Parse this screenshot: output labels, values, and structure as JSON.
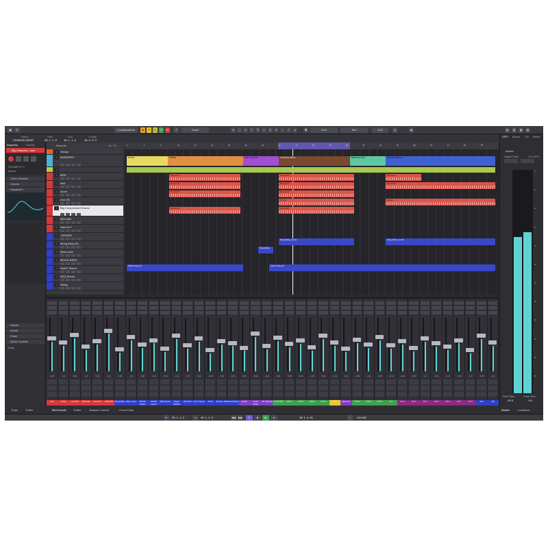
{
  "toolbar": {
    "configurations": "Configurations",
    "touch": "Touch",
    "grid": "Grid",
    "bar": "Bar",
    "quantize": "1/32",
    "section_name": "Name",
    "section_start": "Start",
    "section_end": "End",
    "section_length": "Length",
    "marker_name": "CHORUS DROP",
    "start_value": "33. 1. 1. 0",
    "end_value": "49. 1. 1. 0",
    "length_value": "16. 0. 0. 0"
  },
  "inspector": {
    "tabs": [
      "Inspector",
      "Visibility"
    ],
    "track_name": "Big Compres...mns",
    "sections": [
      "Track Versions",
      "Chords",
      "Equalizers",
      "Inserts",
      "Sends",
      "Fader",
      "Quick Controls"
    ],
    "setup_label": "Setup",
    "input_label": "SOUND ST 1",
    "output_label": "stereo"
  },
  "tracklist": {
    "header_label": "Records",
    "counter": "46 / 76",
    "tracks": [
      {
        "name": "Tempo",
        "color": "#e06820"
      },
      {
        "name": "MARKERS",
        "color": "#50b0d8"
      },
      {
        "name": "",
        "color": "#b0d040"
      },
      {
        "name": "MIDI",
        "color": "#d83838"
      },
      {
        "name": "Kick",
        "color": "#d83838"
      },
      {
        "name": "Drum",
        "color": "#d83838"
      },
      {
        "name": "Live (R)",
        "color": "#d83838"
      },
      {
        "name": "Big Compressed Drums",
        "color": "#d83838"
      },
      {
        "name": "808 Hats",
        "color": "#d83838"
      },
      {
        "name": "Hats DLY",
        "color": "#d83838"
      },
      {
        "name": "+DRUMS",
        "color": "#3040c8"
      },
      {
        "name": "Moog Bass (R)",
        "color": "#3040c8"
      },
      {
        "name": "Bass Lickz",
        "color": "#3040c8"
      },
      {
        "name": "MOOG BASS",
        "color": "#3040c8"
      },
      {
        "name": "Sub37 Stereo",
        "color": "#3040c8"
      },
      {
        "name": "SEQ Stereo",
        "color": "#3040c8"
      },
      {
        "name": "String",
        "color": "#3040c8"
      }
    ]
  },
  "ruler": {
    "marks": [
      "1",
      "5",
      "9",
      "13",
      "17",
      "21",
      "25",
      "29",
      "33",
      "37",
      "41",
      "45",
      "49",
      "53",
      "57",
      "61",
      "65",
      "69",
      "73",
      "77",
      "81",
      "85"
    ]
  },
  "arrange": {
    "sections": [
      {
        "label": "INTRO",
        "color": "#e8d860"
      },
      {
        "label": "VERSE",
        "color": "#e09040"
      },
      {
        "label": "PRE CHORUS",
        "color": "#a050d0"
      },
      {
        "label": "CHORUS DROP",
        "color": "#7a4a30"
      },
      {
        "label": "BREAKDOWN",
        "color": "#60c8a0"
      },
      {
        "label": "INSTRUMENTAL",
        "color": "#4060d0"
      }
    ],
    "parts": [
      {
        "label": "Drums 01",
        "color": "#d8554a"
      },
      {
        "label": "Drums 02",
        "color": "#d8554a"
      },
      {
        "label": "Tempo",
        "color": "#d8554a"
      },
      {
        "label": "Moog Bass_01-01",
        "color": "#3a48c8"
      },
      {
        "label": "Moog Bass_01-02",
        "color": "#3a48c8"
      },
      {
        "label": "Moog Bass",
        "color": "#3a48c8"
      },
      {
        "label": "Sub37 Seq_01",
        "color": "#3a48c8"
      },
      {
        "label": "Sub37 Seq_02",
        "color": "#3a48c8"
      }
    ]
  },
  "mixer": {
    "channels": [
      {
        "name": "Kick",
        "value": "0.00",
        "color": "#d83838",
        "level": 0.55
      },
      {
        "name": "Snare",
        "value": "-6.4",
        "color": "#d83838",
        "level": 0.48
      },
      {
        "name": "Live (R)",
        "value": "0.00",
        "color": "#d83838",
        "level": 0.62
      },
      {
        "name": "808 Hats",
        "value": "-1.9",
        "color": "#d83838",
        "level": 0.4
      },
      {
        "name": "Hats DLY",
        "value": "0.00",
        "color": "#d83838",
        "level": 0.5
      },
      {
        "name": "+DRUMS",
        "value": "-2.2",
        "color": "#d83838",
        "level": 0.7
      },
      {
        "name": "Moog Bass",
        "value": "0.00",
        "color": "#3040c8",
        "level": 0.35
      },
      {
        "name": "Bass Lickz",
        "value": "-0.4",
        "color": "#3040c8",
        "level": 0.58
      },
      {
        "name": "MOOG BASS",
        "value": "0.00",
        "color": "#3040c8",
        "level": 0.44
      },
      {
        "name": "Sub37 Stereo",
        "value": "-6.31",
        "color": "#3040c8",
        "level": 0.52
      },
      {
        "name": "SEQ Stereo",
        "value": "-5.44",
        "color": "#3040c8",
        "level": 0.36
      },
      {
        "name": "Trigger Hatfield",
        "value": "-13.4",
        "color": "#3040c8",
        "level": 0.6
      },
      {
        "name": "FM Warm",
        "value": "-4.77",
        "color": "#3040c8",
        "level": 0.42
      },
      {
        "name": "Sci-Fi Synth",
        "value": "0.00",
        "color": "#3040c8",
        "level": 0.55
      },
      {
        "name": "Pluck",
        "value": "-1.06",
        "color": "#3040c8",
        "level": 0.33
      },
      {
        "name": "Modern Bell",
        "value": "-7.40",
        "color": "#3040c8",
        "level": 0.5
      },
      {
        "name": "Dark Strings",
        "value": "-18.6",
        "color": "#3040c8",
        "level": 0.47
      },
      {
        "name": "Jupiter",
        "value": "0.00",
        "color": "#8040c0",
        "level": 0.38
      },
      {
        "name": "Comb Snare",
        "value": "-5.69",
        "color": "#8040c0",
        "level": 0.64
      },
      {
        "name": "CR Ultimate",
        "value": "-13.4",
        "color": "#8040c0",
        "level": 0.41
      },
      {
        "name": "+SYNTHS",
        "value": "0.00",
        "color": "#3ea050",
        "level": 0.57
      },
      {
        "name": "GTR 1",
        "value": "-9.59",
        "color": "#3ea050",
        "level": 0.45
      },
      {
        "name": "GTR 2",
        "value": "-6.62",
        "color": "#3ea050",
        "level": 0.51
      },
      {
        "name": "GTR 3",
        "value": "-2.87",
        "color": "#3ea050",
        "level": 0.39
      },
      {
        "name": "GTR 4",
        "value": "0.00",
        "color": "#3ea050",
        "level": 0.6
      },
      {
        "name": "Vox",
        "value": "-2.31",
        "color": "#e8c830",
        "level": 0.48
      },
      {
        "name": "Wav Dur",
        "value": "-17.2",
        "color": "#8040c0",
        "level": 0.36
      },
      {
        "name": "GTR 5",
        "value": "-1.89",
        "color": "#3ea050",
        "level": 0.53
      },
      {
        "name": "GTR 6",
        "value": "-3.61",
        "color": "#3ea050",
        "level": 0.44
      },
      {
        "name": "GTR 7",
        "value": "-8.45",
        "color": "#3ea050",
        "level": 0.58
      },
      {
        "name": "FX 1",
        "value": "-6.74",
        "color": "#3ea050",
        "level": 0.42
      },
      {
        "name": "FX 2",
        "value": "-0.26",
        "color": "#8a2a80",
        "level": 0.5
      },
      {
        "name": "FX 3",
        "value": "-0.65",
        "color": "#8a2a80",
        "level": 0.37
      },
      {
        "name": "FX 4",
        "value": "-2.2",
        "color": "#8a2a80",
        "level": 0.55
      },
      {
        "name": "FX 5",
        "value": "-0.11",
        "color": "#8a2a80",
        "level": 0.46
      },
      {
        "name": "FX 6",
        "value": "-4.17",
        "color": "#8a2a80",
        "level": 0.4
      },
      {
        "name": "FX 7",
        "value": "-6.10",
        "color": "#8a2a80",
        "level": 0.52
      },
      {
        "name": "FX 8",
        "value": "-6.3",
        "color": "#8a2a80",
        "level": 0.33
      },
      {
        "name": "Rev",
        "value": "-6.45",
        "color": "#3040c8",
        "level": 0.6
      },
      {
        "name": "Dly",
        "value": "-0.2",
        "color": "#3040c8",
        "level": 0.48
      }
    ]
  },
  "right_panel": {
    "tabs": [
      "VSTi",
      "Media",
      "CR",
      "Meter"
    ],
    "meter_title": "Master",
    "digital_peak_label": "Digital Peak",
    "scale_label": "-14 LUFS",
    "scale": [
      "0",
      "5",
      "10",
      "15",
      "20",
      "25",
      "30",
      "35",
      "40",
      "45",
      "50",
      "55"
    ],
    "rms_label": "RMS Max",
    "peak_label": "Peak Max",
    "rms_value": "-10.3",
    "peak_value": "-3.0",
    "bottom_tabs": [
      "Master",
      "Loudness"
    ],
    "meter_levels": {
      "left": 0.7,
      "right": 0.72
    }
  },
  "bottom": {
    "tabs": [
      "Track",
      "Editor",
      "MixConsole",
      "Editor",
      "Sampler Control",
      "Chord Pads"
    ]
  },
  "transport": {
    "left_locator": "33. 1. 1. 0",
    "right_locator": "49. 1. 1. 0",
    "position": "38. 1. 4. 61",
    "tempo": "124.000"
  },
  "colors": {
    "accent": "#f0c020",
    "background": "#2b2b2f",
    "drum_red": "#d8554a",
    "synth_blue": "#3a48c8",
    "meter_cyan": "#5fd3d3"
  }
}
